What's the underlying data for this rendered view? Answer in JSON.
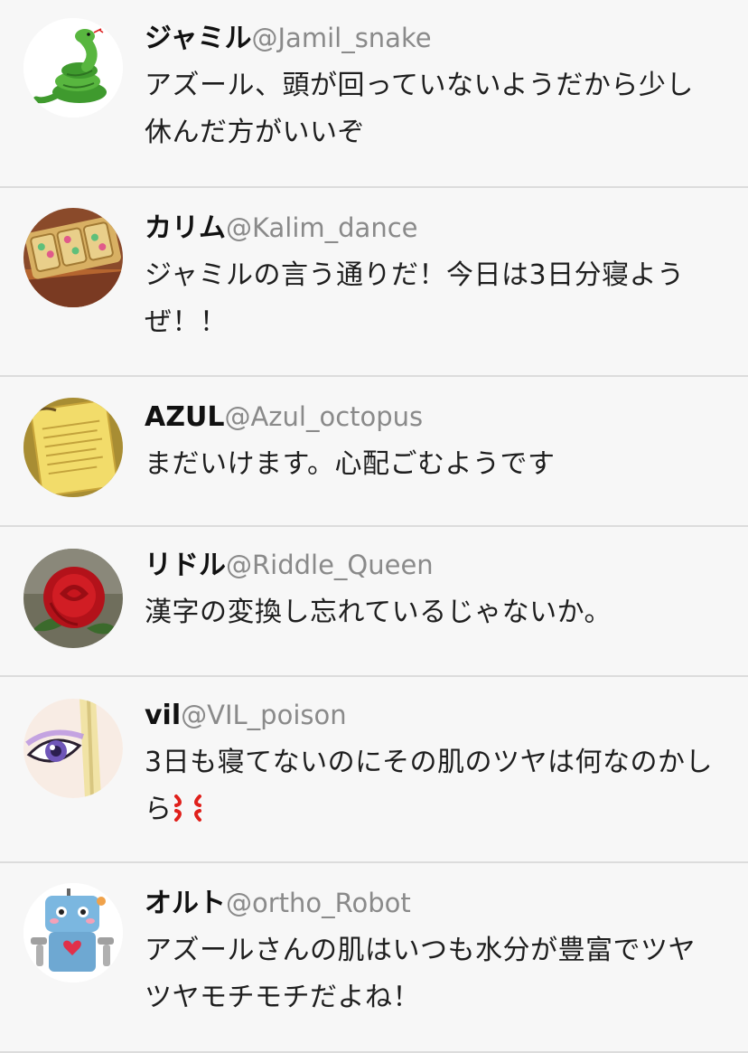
{
  "posts": [
    {
      "display_name": "ジャミル",
      "handle": "@Jamil_snake",
      "message": "アズール、頭が回っていないようだから少し休んだ方がいいぞ",
      "avatar_icon": "snake-icon"
    },
    {
      "display_name": "カリム",
      "handle": "@Kalim_dance",
      "message": "ジャミルの言う通りだ！今日は3日分寝ようぜ！！",
      "avatar_icon": "jeweled-tiles-avatar"
    },
    {
      "display_name": "AZUL",
      "handle": "@Azul_octopus",
      "message": "まだいけます。心配ごむようです",
      "avatar_icon": "golden-contract-avatar"
    },
    {
      "display_name": "リドル",
      "handle": "@Riddle_Queen",
      "message": "漢字の変換し忘れているじゃないか。",
      "avatar_icon": "red-rose-avatar"
    },
    {
      "display_name": "vil",
      "handle": "@VIL_poison",
      "message": "3日も寝てないのにその肌のツヤは何なのかしら",
      "emoji": "anger-icon",
      "avatar_icon": "purple-eye-avatar"
    },
    {
      "display_name": "オルト",
      "handle": "@ortho_Robot",
      "message": "アズールさんの肌はいつも水分が豊富でツヤツヤモチモチだよね！",
      "avatar_icon": "robot-icon"
    }
  ]
}
